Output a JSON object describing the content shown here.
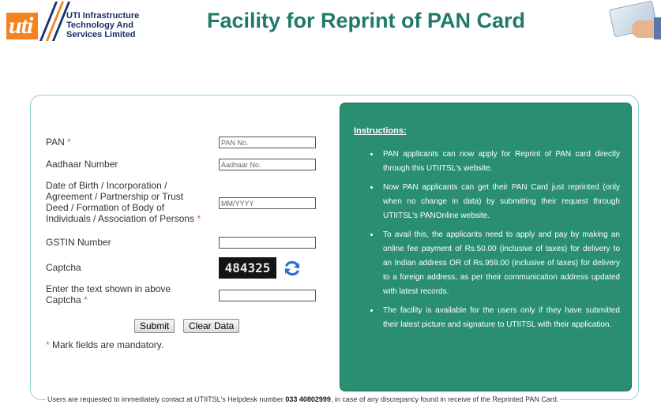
{
  "header": {
    "logo_text": "uti",
    "org_line1": "UTI Infrastructure",
    "org_line2": "Technology And",
    "org_line3": "Services Limited",
    "title": "Facility for Reprint of PAN Card"
  },
  "form": {
    "pan_label": "PAN",
    "pan_placeholder": "PAN No.",
    "aadhaar_label": "Aadhaar Number",
    "aadhaar_placeholder": "Aadhaar No.",
    "dob_label_1": "Date of Birth / Incorporation /",
    "dob_label_2": "Agreement / Partnership or Trust",
    "dob_label_3": "Deed / Formation of Body of",
    "dob_label_4": "Individuals / Association of Persons",
    "dob_placeholder": "MM/YYYY",
    "gstin_label": "GSTIN Number",
    "gstin_value": "",
    "captcha_label": "Captcha",
    "captcha_value": "484325",
    "captcha_input_label_1": "Enter the text shown in above",
    "captcha_input_label_2": "Captcha",
    "captcha_input_value": "",
    "required_mark": "*",
    "submit_label": "Submit",
    "clear_label": "Clear Data",
    "mandatory_note": "Mark fields are mandatory."
  },
  "instructions": {
    "title": "Instructions:",
    "items": [
      "PAN applicants can now apply for Reprint of PAN card directly through this UTIITSL's website.",
      "Now PAN applicants can get their PAN Card just reprinted (only when no change in data) by submitting their request through UTIITSL's PANOnline website.",
      "To avail this, the applicants need to apply and pay by making an online fee payment of Rs.50.00 (inclusive of taxes) for delivery to an Indian address OR of Rs.959.00 (inclusive of taxes) for delivery to a foreign address, as per their communication address updated with latest records.",
      "The facility is available for the users only if they have submitted their latest picture and signature to UTIITSL with their application."
    ]
  },
  "footer": {
    "note_before": "Users are requested to immediately contact at UTIITSL's Helpdesk number ",
    "helpdesk_number": "033 40802999",
    "note_after": ", in case of any discrepancy found in receive of the Reprinted PAN Card."
  },
  "colors": {
    "brand_orange": "#f58220",
    "brand_navy": "#1b2e6e",
    "title_green": "#1f7a6a",
    "panel_green": "#2a8f72",
    "frame_border": "#8fd1d4",
    "required_red": "#e05a5a"
  },
  "icons": {
    "refresh": "refresh-icon",
    "pan_card_image": "pan-card-image"
  }
}
